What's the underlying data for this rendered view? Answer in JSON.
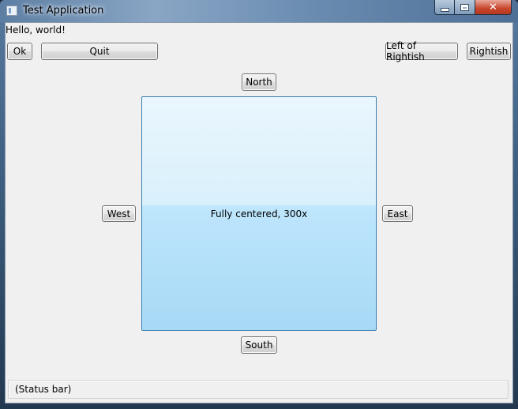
{
  "window": {
    "title": "Test Application"
  },
  "greeting": "Hello, world!",
  "buttons": {
    "ok": "Ok",
    "quit": "Quit",
    "left_of_rightish": "Left of Rightish",
    "rightish": "Rightish",
    "north": "North",
    "west": "West",
    "east": "East",
    "south": "South"
  },
  "center_panel": {
    "label": "Fully centered, 300x"
  },
  "status_bar": {
    "text": "(Status bar)"
  },
  "colors": {
    "client_background": "#f0f0f0",
    "center_border": "#3c7fb1",
    "center_fill_top": "#eaf6fd",
    "center_fill_bottom": "#a7d9f5",
    "close_button": "#c7452b"
  }
}
